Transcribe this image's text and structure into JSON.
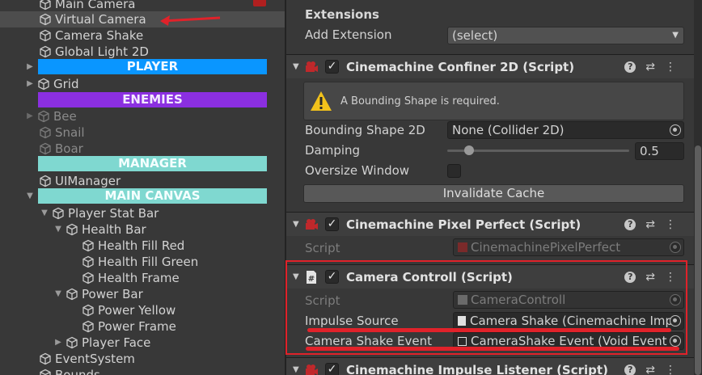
{
  "hierarchy": {
    "items": [
      {
        "label": "Main Camera"
      },
      {
        "label": "Virtual Camera"
      },
      {
        "label": "Camera Shake"
      },
      {
        "label": "Global Light 2D"
      },
      {
        "label": "Grid"
      },
      {
        "label": "Bee"
      },
      {
        "label": "Snail"
      },
      {
        "label": "Boar"
      },
      {
        "label": "UIManager"
      },
      {
        "label": "Player Stat Bar"
      },
      {
        "label": "Health Bar"
      },
      {
        "label": "Health Fill Red"
      },
      {
        "label": "Health Fill Green"
      },
      {
        "label": "Health Frame"
      },
      {
        "label": "Power Bar"
      },
      {
        "label": "Power Yellow"
      },
      {
        "label": "Power Frame"
      },
      {
        "label": "Player Face"
      },
      {
        "label": "EventSystem"
      },
      {
        "label": "Bounds"
      }
    ],
    "bands": {
      "player": "PLAYER",
      "enemies": "ENEMIES",
      "manager": "MANAGER",
      "canvas": "MAIN CANVAS"
    }
  },
  "inspector": {
    "extensions": {
      "heading": "Extensions",
      "add_label": "Add Extension",
      "add_value": "(select)"
    },
    "confiner": {
      "title": "Cinemachine Confiner 2D (Script)",
      "warning": "A Bounding Shape is required.",
      "bounding_label": "Bounding Shape 2D",
      "bounding_value": "None (Collider 2D)",
      "damping_label": "Damping",
      "damping_value": "0.5",
      "damping_fraction": 0.5,
      "oversize_label": "Oversize Window",
      "invalidate_label": "Invalidate Cache"
    },
    "pixel_perfect": {
      "title": "Cinemachine Pixel Perfect (Script)",
      "script_label": "Script",
      "script_value": "CinemachinePixelPerfect"
    },
    "camera_controll": {
      "title": "Camera Controll (Script)",
      "script_label": "Script",
      "script_value": "CameraControll",
      "impulse_label": "Impulse Source",
      "impulse_value": "Camera Shake (Cinemachine Impu",
      "event_label": "Camera Shake Event",
      "event_value": "CameraShake Event (Void Event S"
    },
    "impulse_listener": {
      "title": "Cinemachine Impulse Listener (Script)"
    }
  },
  "colors": {
    "player_band": "#0a96ff",
    "enemies_band": "#8b2fe0",
    "manager_band": "#7fd8d0",
    "annotation_red": "#e0222a"
  },
  "icons": [
    "cube-icon",
    "foldout-icon",
    "object-picker-icon",
    "warning-icon",
    "help-icon",
    "preset-icon",
    "kebab-menu-icon",
    "checkbox-icon",
    "script-icon"
  ]
}
